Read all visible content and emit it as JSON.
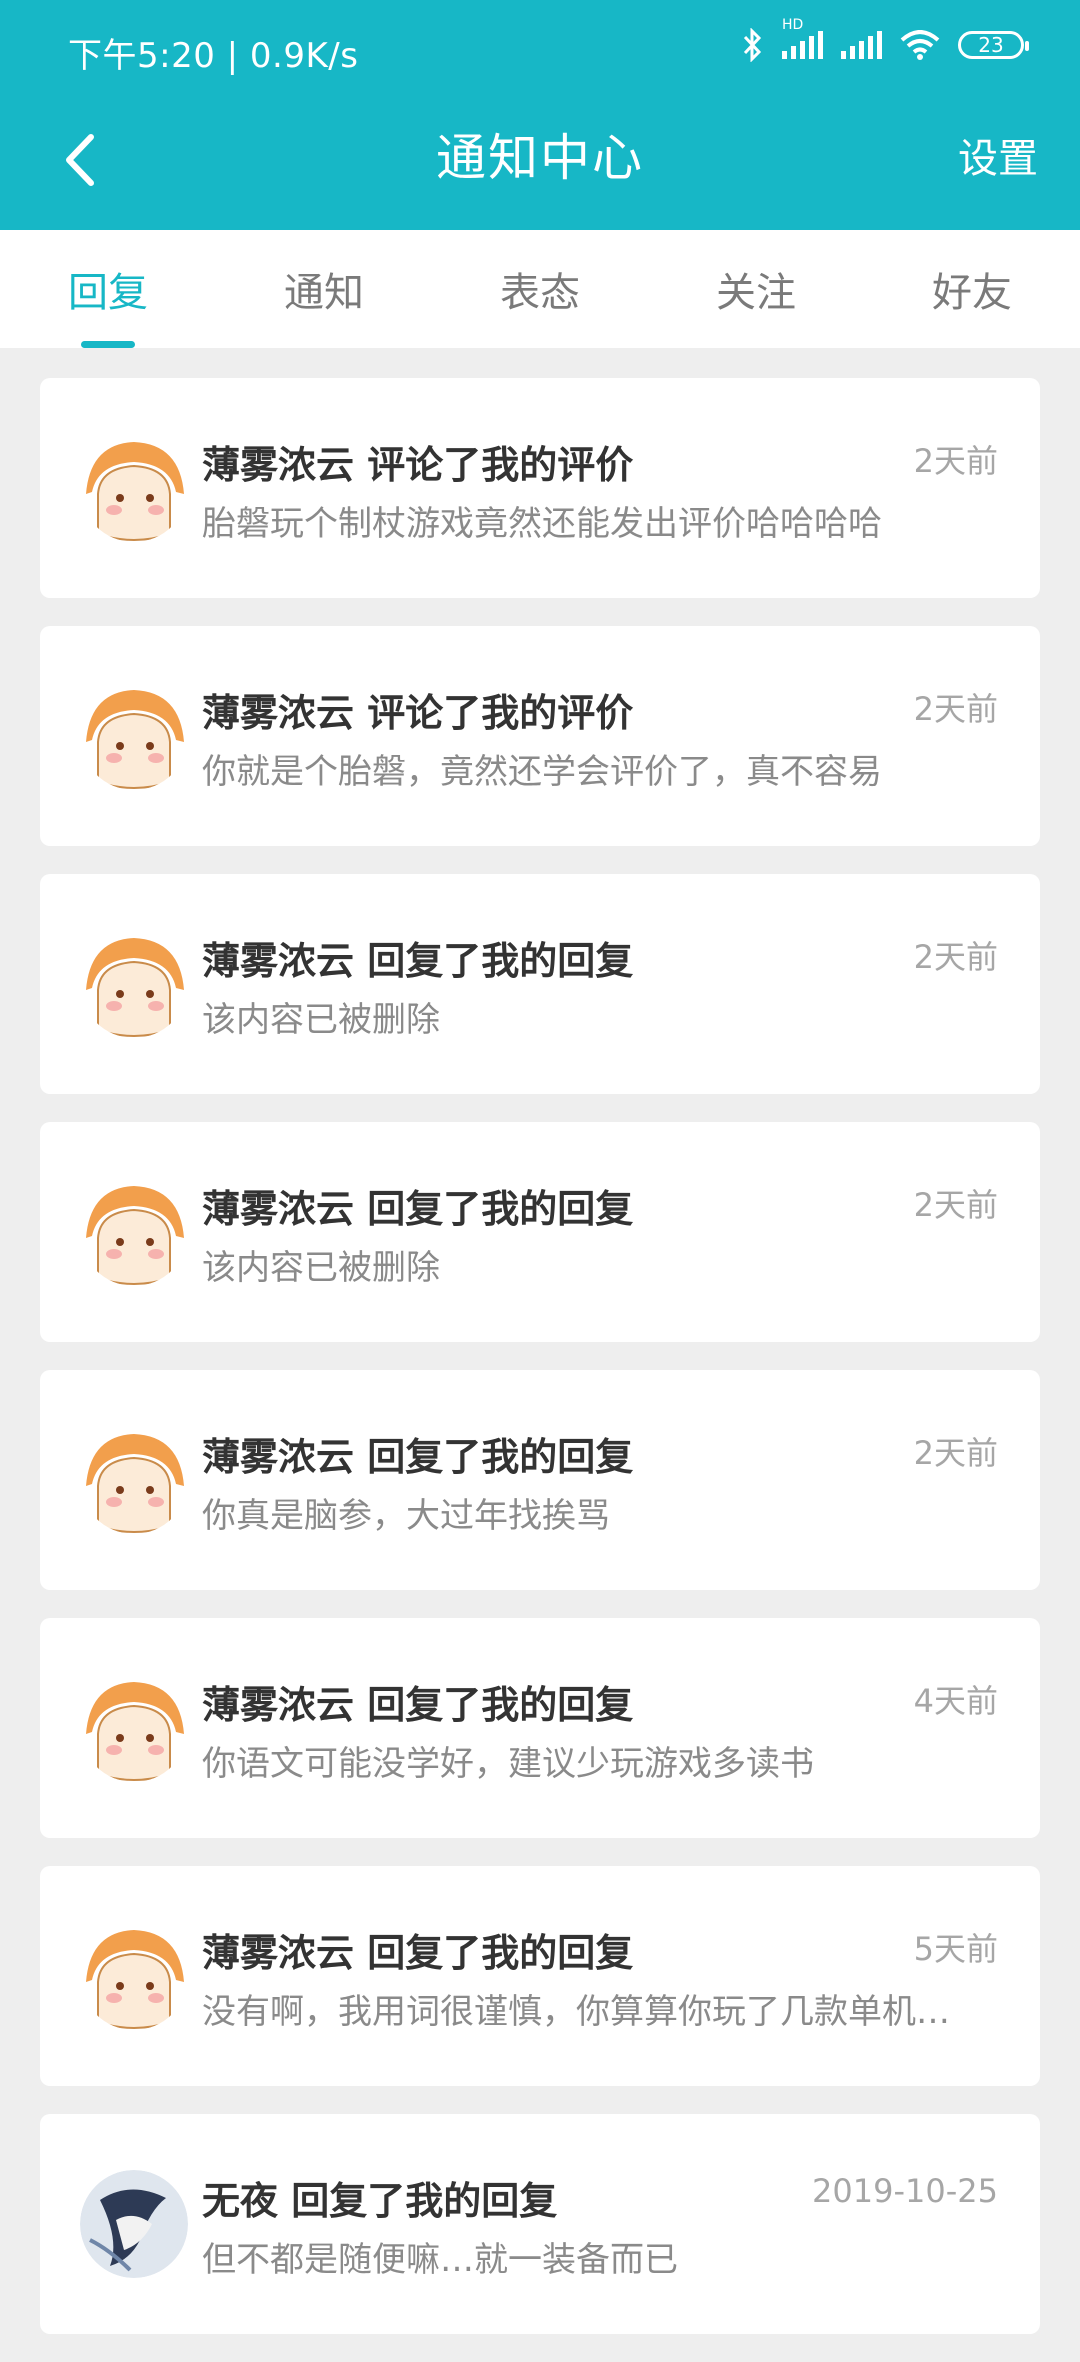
{
  "status_bar": {
    "time_speed": "下午5:20 | 0.9K/s",
    "hd_label": "HD",
    "battery": "23"
  },
  "header": {
    "back_icon": "chevron-left-icon",
    "title": "通知中心",
    "settings_label": "设置"
  },
  "tabs": [
    {
      "label": "回复",
      "active": true
    },
    {
      "label": "通知",
      "active": false
    },
    {
      "label": "表态",
      "active": false
    },
    {
      "label": "关注",
      "active": false
    },
    {
      "label": "好友",
      "active": false
    }
  ],
  "notifications": [
    {
      "user": "薄雾浓云",
      "action": "评论了我的评价",
      "time": "2天前",
      "content": "胎磐玩个制杖游戏竟然还能发出评价哈哈哈哈"
    },
    {
      "user": "薄雾浓云",
      "action": "评论了我的评价",
      "time": "2天前",
      "content": "你就是个胎磐，竟然还学会评价了，真不容易"
    },
    {
      "user": "薄雾浓云",
      "action": "回复了我的回复",
      "time": "2天前",
      "content": "该内容已被删除"
    },
    {
      "user": "薄雾浓云",
      "action": "回复了我的回复",
      "time": "2天前",
      "content": "该内容已被删除"
    },
    {
      "user": "薄雾浓云",
      "action": "回复了我的回复",
      "time": "2天前",
      "content": "你真是脑参，大过年找挨骂"
    },
    {
      "user": "薄雾浓云",
      "action": "回复了我的回复",
      "time": "4天前",
      "content": "你语文可能没学好，建议少玩游戏多读书"
    },
    {
      "user": "薄雾浓云",
      "action": "回复了我的回复",
      "time": "5天前",
      "content": "没有啊，我用词很谨慎，你算算你玩了几款单机…"
    },
    {
      "user": "无夜",
      "action": "回复了我的回复",
      "time": "2019-10-25",
      "content": "但不都是随便嘛…就一装备而已"
    }
  ],
  "colors": {
    "accent": "#17b7c6"
  }
}
